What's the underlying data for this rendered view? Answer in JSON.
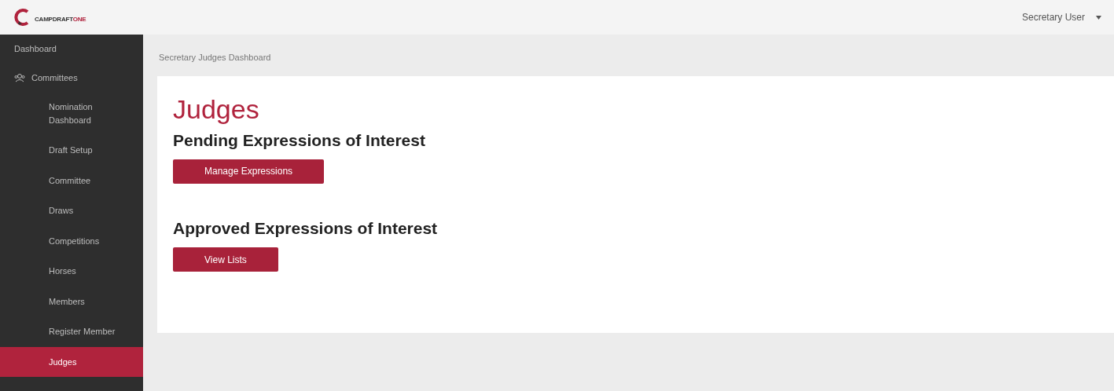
{
  "logo": {
    "text": "CAMPDRAFT",
    "accent": "ONE"
  },
  "user_menu": {
    "label": "Secretary User"
  },
  "sidebar": {
    "items": [
      {
        "label": "Dashboard",
        "selected": false
      },
      {
        "label": "Committees",
        "selected": false,
        "children": [
          {
            "label": "Nomination Dashboard",
            "selected": false
          },
          {
            "label": "Draft Setup",
            "selected": false
          },
          {
            "label": "Committee",
            "selected": false
          },
          {
            "label": "Draws",
            "selected": false
          },
          {
            "label": "Competitions",
            "selected": false
          },
          {
            "label": "Horses",
            "selected": false
          },
          {
            "label": "Members",
            "selected": false
          },
          {
            "label": "Register Member",
            "selected": false
          },
          {
            "label": "Judges",
            "selected": true
          }
        ]
      }
    ]
  },
  "breadcrumb": "Secretary Judges Dashboard",
  "page_title": "Judges",
  "sections": [
    {
      "heading": "Pending Expressions of Interest",
      "button": "Manage Expressions"
    },
    {
      "heading": "Approved Expressions of Interest",
      "button": "View Lists"
    }
  ]
}
